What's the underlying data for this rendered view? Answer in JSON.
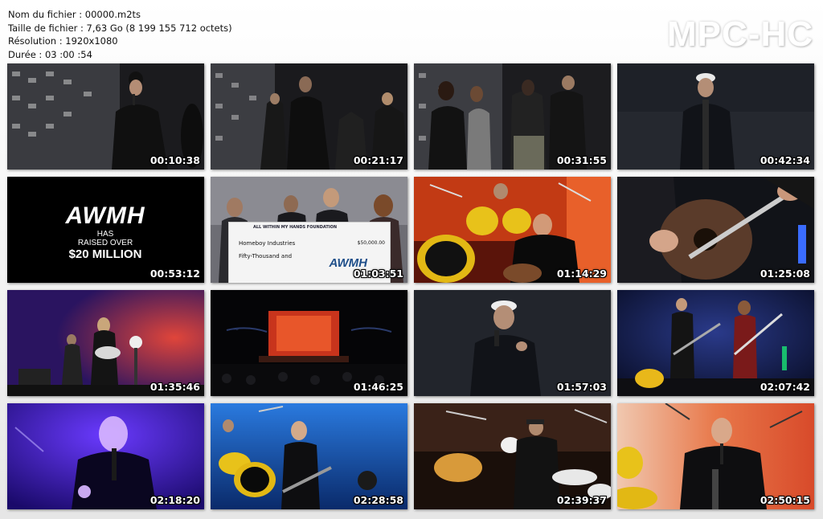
{
  "file_info": {
    "name_line": "Nom du fichier : 00000.m2ts",
    "size_line": "Taille de fichier : 7,63 Go (8 199 155 712 octets)",
    "resolution_line": "Résolution : 1920x1080",
    "duration_line": "Durée : 03 :00 :54"
  },
  "logo": "MPC-HC",
  "awmh_slide": {
    "logo": "AWMH",
    "line1": "HAS",
    "line2": "RAISED OVER",
    "line3": "$20 MILLION"
  },
  "check": {
    "foundation": "ALL WITHIN MY HANDS FOUNDATION",
    "payee": "Homeboy Industries",
    "amount_words": "Fifty-Thousand and",
    "amount": "$50,000.00",
    "logo": "AWMH"
  },
  "thumbnails": [
    {
      "timestamp": "00:10:38",
      "scene": "red-carpet"
    },
    {
      "timestamp": "00:21:17",
      "scene": "red-carpet"
    },
    {
      "timestamp": "00:31:55",
      "scene": "red-carpet-group"
    },
    {
      "timestamp": "00:42:34",
      "scene": "host-santa"
    },
    {
      "timestamp": "00:53:12",
      "scene": "awmh-slide"
    },
    {
      "timestamp": "01:03:51",
      "scene": "check"
    },
    {
      "timestamp": "01:14:29",
      "scene": "drums-red"
    },
    {
      "timestamp": "01:25:08",
      "scene": "guitar-closeup"
    },
    {
      "timestamp": "01:35:46",
      "scene": "stage-red"
    },
    {
      "timestamp": "01:46:25",
      "scene": "stage-wide"
    },
    {
      "timestamp": "01:57:03",
      "scene": "host-santa"
    },
    {
      "timestamp": "02:07:42",
      "scene": "stage-blue"
    },
    {
      "timestamp": "02:18:20",
      "scene": "singer-purple"
    },
    {
      "timestamp": "02:28:58",
      "scene": "band-blue"
    },
    {
      "timestamp": "02:39:37",
      "scene": "drummer-back"
    },
    {
      "timestamp": "02:50:15",
      "scene": "singer-orange"
    }
  ]
}
